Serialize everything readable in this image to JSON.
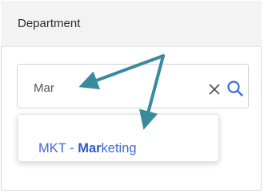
{
  "header": {
    "label": "Department"
  },
  "search": {
    "value": "Mar",
    "clear_icon": "close-icon",
    "search_icon": "search-icon"
  },
  "dropdown": {
    "options": [
      {
        "prefix": "MKT - ",
        "match": "Mar",
        "rest": "keting"
      }
    ]
  },
  "colors": {
    "accent": "#3d6ad6",
    "annotation_arrow": "#3a8a9e",
    "header_bg": "#f3f3f3"
  }
}
